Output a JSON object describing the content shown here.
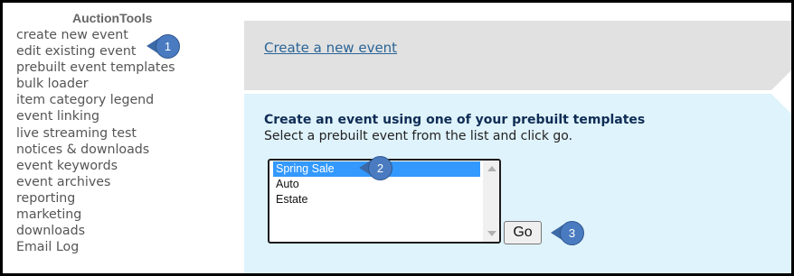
{
  "sidebar": {
    "title": "AuctionTools",
    "items": [
      {
        "label": "create new event"
      },
      {
        "label": "edit existing event"
      },
      {
        "label": "prebuilt event templates"
      },
      {
        "label": "bulk loader"
      },
      {
        "label": "item category legend"
      },
      {
        "label": "event linking"
      },
      {
        "label": "live streaming test"
      },
      {
        "label": "notices & downloads"
      },
      {
        "label": "event keywords"
      },
      {
        "label": "event archives"
      },
      {
        "label": "reporting"
      },
      {
        "label": "marketing"
      },
      {
        "label": "downloads"
      },
      {
        "label": "Email Log"
      }
    ]
  },
  "create_panel": {
    "link_label": "Create a new event"
  },
  "template_panel": {
    "heading": "Create an event using one of your prebuilt templates",
    "instruction": "Select a prebuilt event from the list and click go.",
    "options": [
      "Spring Sale",
      "Auto",
      "Estate"
    ],
    "selected_option": "Spring Sale",
    "go_label": "Go"
  },
  "callouts": [
    "1",
    "2",
    "3"
  ],
  "colors": {
    "link": "#2a6496",
    "heading": "#0f2d55",
    "top_panel_bg": "#e1e1e1",
    "bottom_panel_bg": "#dff3fc",
    "selection": "#3399ff",
    "callout": "#4a7bc1"
  }
}
